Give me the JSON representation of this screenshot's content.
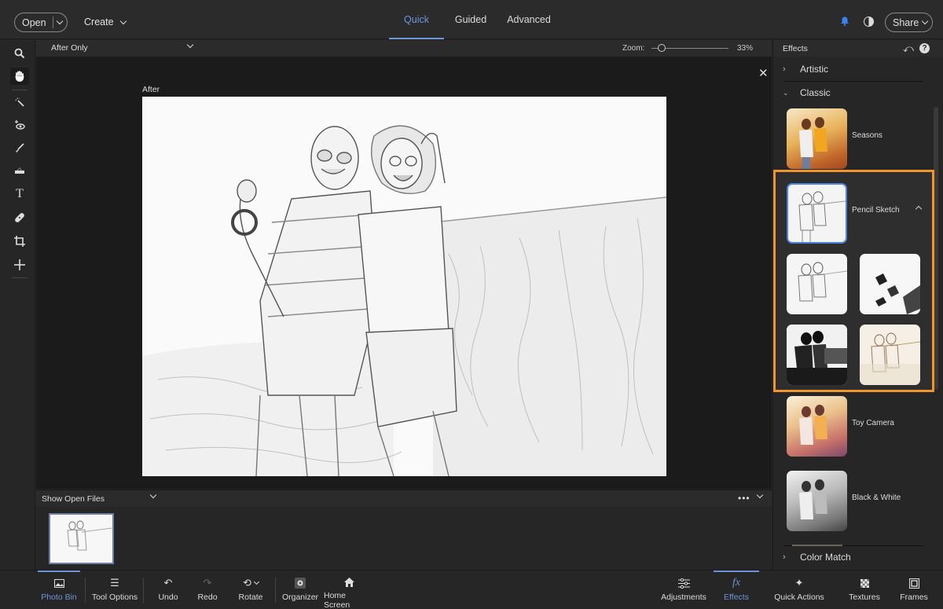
{
  "topbar": {
    "open_label": "Open",
    "create_label": "Create",
    "tabs": [
      {
        "label": "Quick",
        "active": true
      },
      {
        "label": "Guided",
        "active": false
      },
      {
        "label": "Advanced",
        "active": false
      }
    ],
    "share_label": "Share",
    "icons": {
      "notifications": "bell-icon",
      "theme": "contrast-icon"
    },
    "accent_color": "#6e95d8"
  },
  "toolbar": {
    "tools": [
      {
        "name": "zoom-tool",
        "icon": "magnifier"
      },
      {
        "name": "hand-tool",
        "icon": "hand",
        "active": true
      },
      {
        "name": "quick-selection-tool",
        "icon": "magic-wand"
      },
      {
        "name": "red-eye-tool",
        "icon": "eye-plus"
      },
      {
        "name": "whiten-teeth-tool",
        "icon": "brush"
      },
      {
        "name": "straighten-tool",
        "icon": "level"
      },
      {
        "name": "type-tool",
        "icon": "T"
      },
      {
        "name": "spot-healing-tool",
        "icon": "bandage"
      },
      {
        "name": "crop-tool",
        "icon": "crop"
      },
      {
        "name": "move-tool",
        "icon": "plus-move"
      }
    ]
  },
  "view": {
    "mode": "After Only",
    "zoom_label": "Zoom:",
    "zoom_value": "33%",
    "zoom_percent": 33,
    "after_label": "After"
  },
  "photo_bin": {
    "selector_label": "Show Open Files",
    "more": "•••"
  },
  "effects_panel": {
    "title": "Effects",
    "categories": [
      {
        "label": "Artistic",
        "expanded": false
      },
      {
        "label": "Classic",
        "expanded": true
      },
      {
        "label": "Color Match",
        "expanded": false
      }
    ],
    "effects": [
      {
        "label": "Seasons"
      },
      {
        "label": "Pencil Sketch",
        "selected": true,
        "expanded": true,
        "variants": 4
      },
      {
        "label": "Toy Camera"
      },
      {
        "label": "Black & White"
      }
    ],
    "highlight_color": "#f0952b"
  },
  "bottombar": {
    "left": [
      {
        "label": "Photo Bin",
        "active": true
      },
      {
        "label": "Tool Options"
      },
      {
        "label": "Undo"
      },
      {
        "label": "Redo",
        "disabled": true
      },
      {
        "label": "Rotate"
      },
      {
        "label": "Organizer"
      },
      {
        "label": "Home Screen"
      }
    ],
    "right": [
      {
        "label": "Adjustments"
      },
      {
        "label": "Effects",
        "active": true
      },
      {
        "label": "Quick Actions"
      },
      {
        "label": "Textures"
      },
      {
        "label": "Frames"
      }
    ]
  }
}
